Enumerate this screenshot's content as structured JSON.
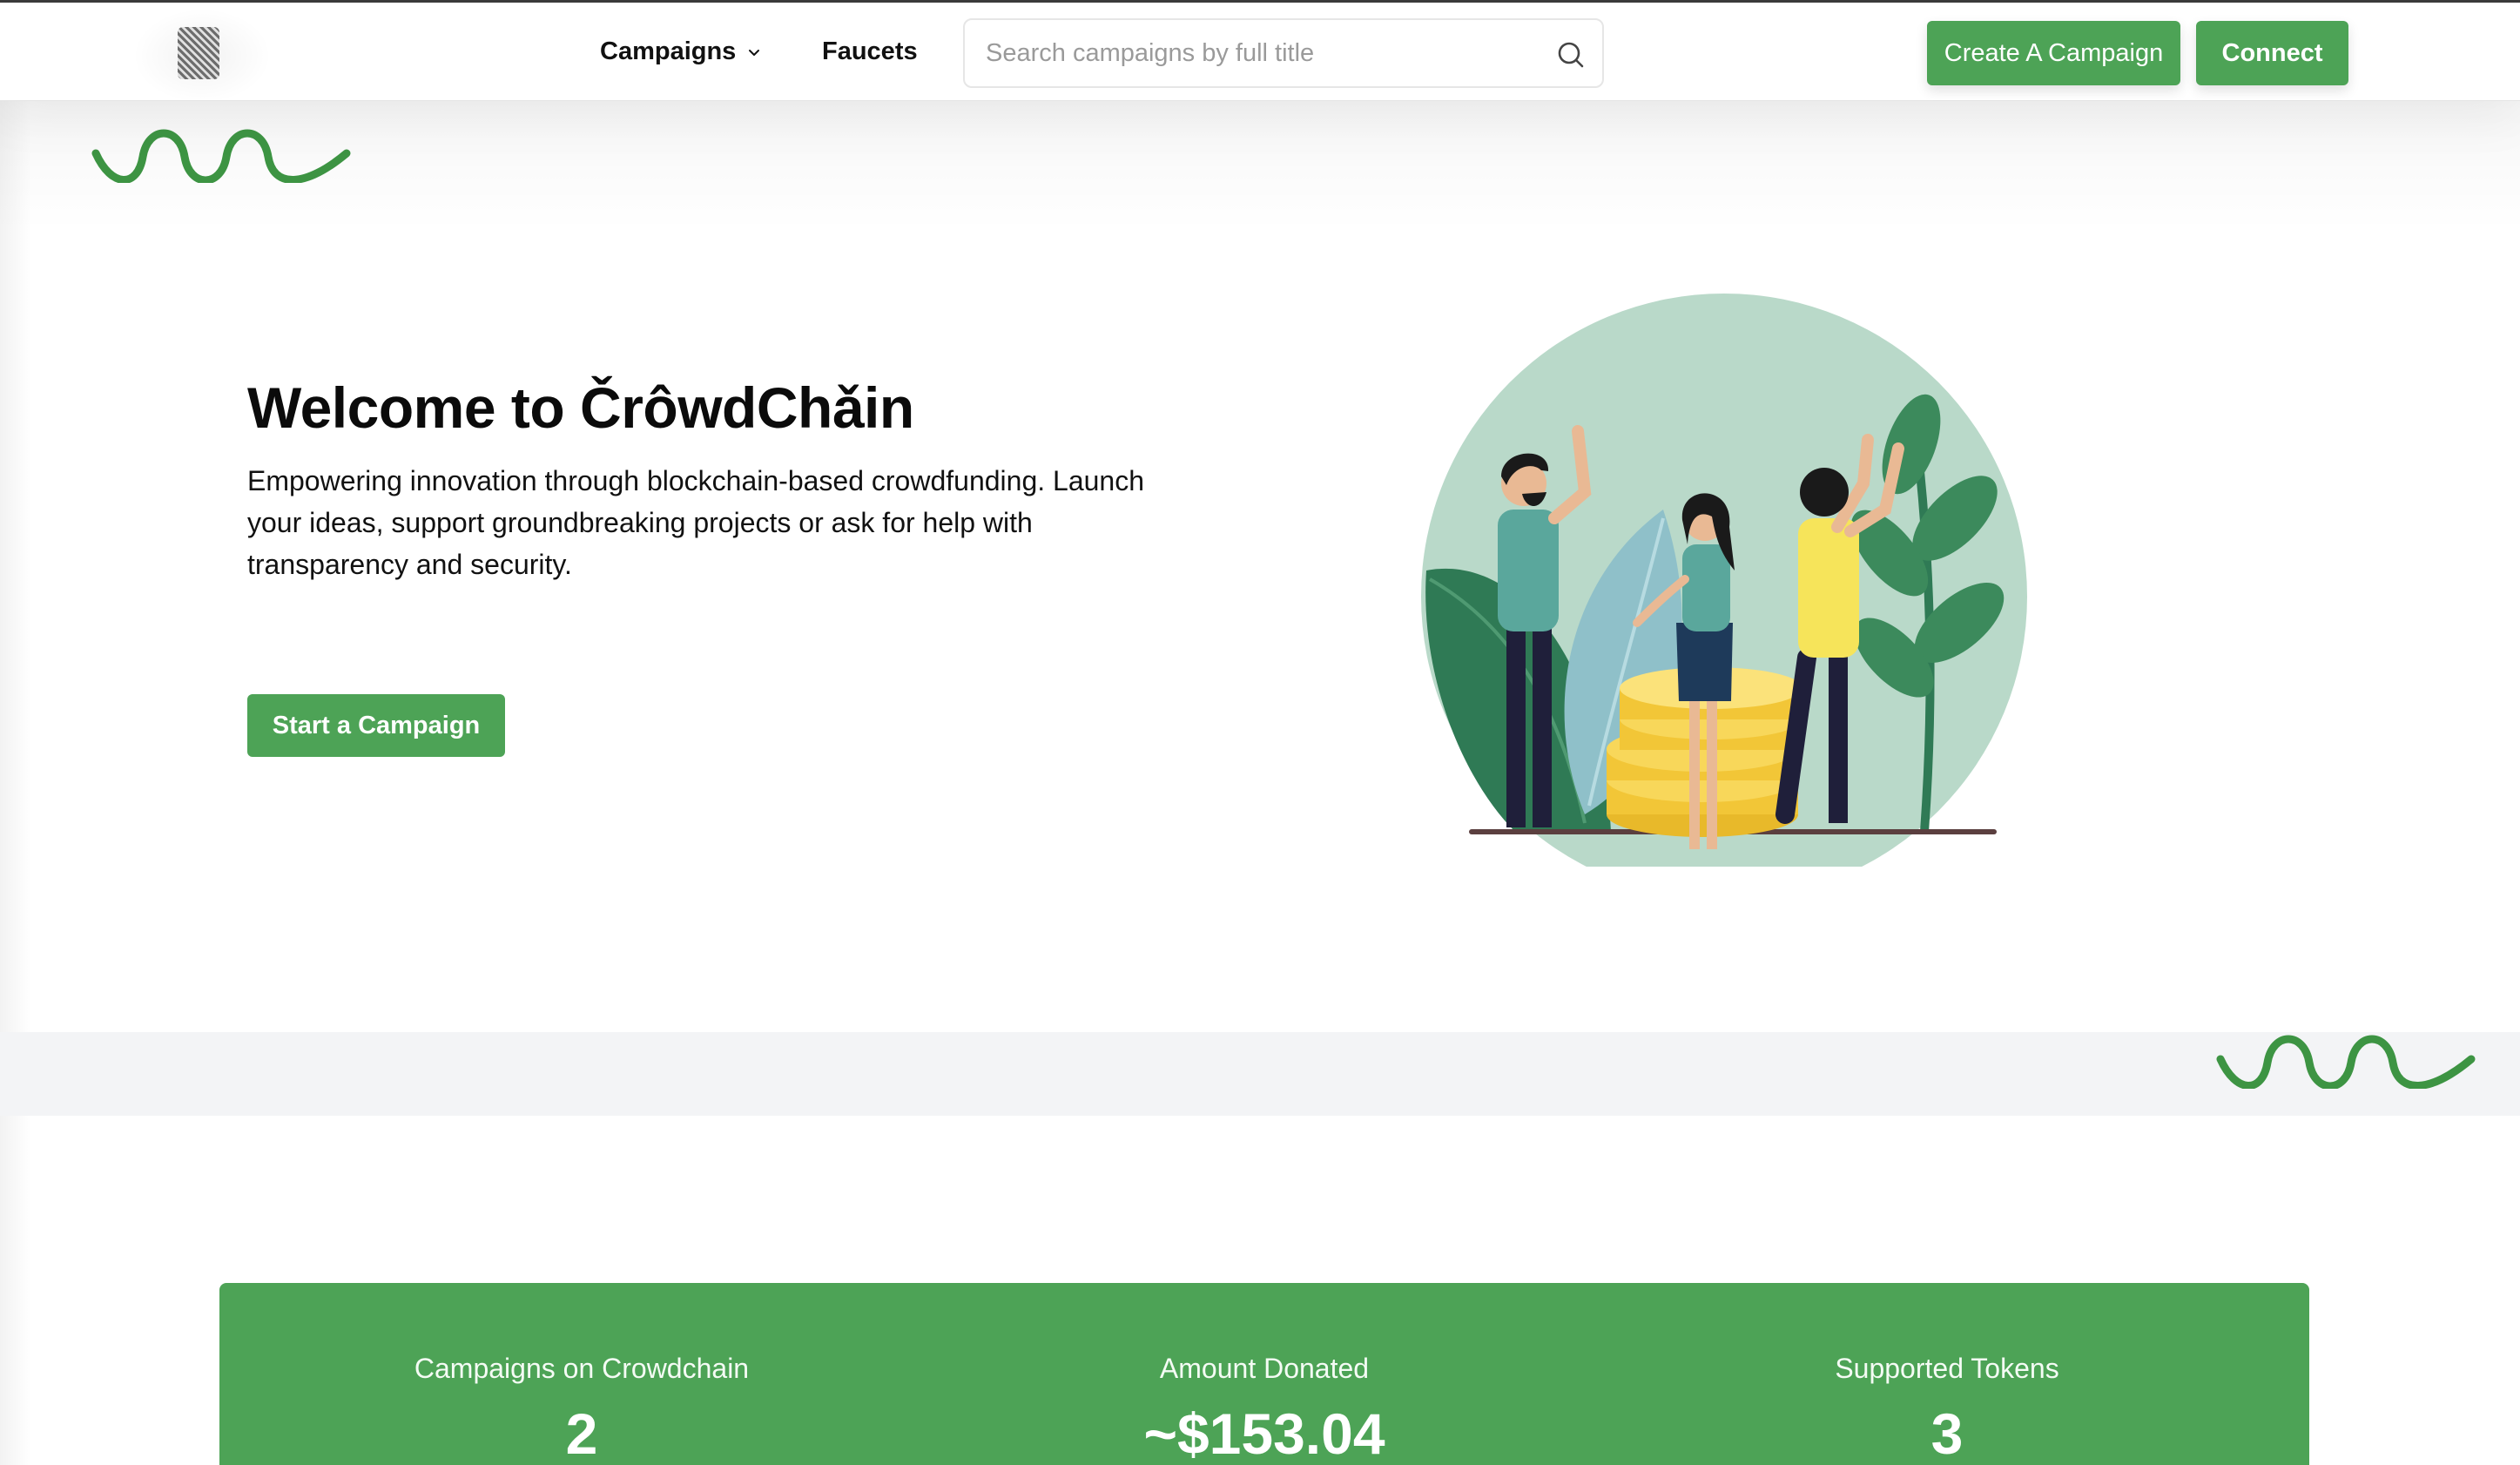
{
  "header": {
    "nav": {
      "campaigns_label": "Campaigns",
      "faucets_label": "Faucets"
    },
    "search": {
      "placeholder": "Search campaigns by full title",
      "icon": "search-icon"
    },
    "create_button_label": "Create A Campaign",
    "connect_button_label": "Connect"
  },
  "hero": {
    "title": "Welcome to ČrôwdChǎin",
    "description": "Empowering innovation through blockchain-based crowdfunding. Launch your ideas, support groundbreaking projects or ask for help with transparency and security.",
    "cta_label": "Start a Campaign"
  },
  "stats": {
    "items": [
      {
        "label": "Campaigns on Crowdchain",
        "value": "2"
      },
      {
        "label": "Amount Donated",
        "value": "~$153.04"
      },
      {
        "label": "Supported Tokens",
        "value": "3"
      }
    ]
  },
  "colors": {
    "accent": "#4da356",
    "band": "#f3f4f6",
    "illustration_circle": "#b9d9c9"
  }
}
